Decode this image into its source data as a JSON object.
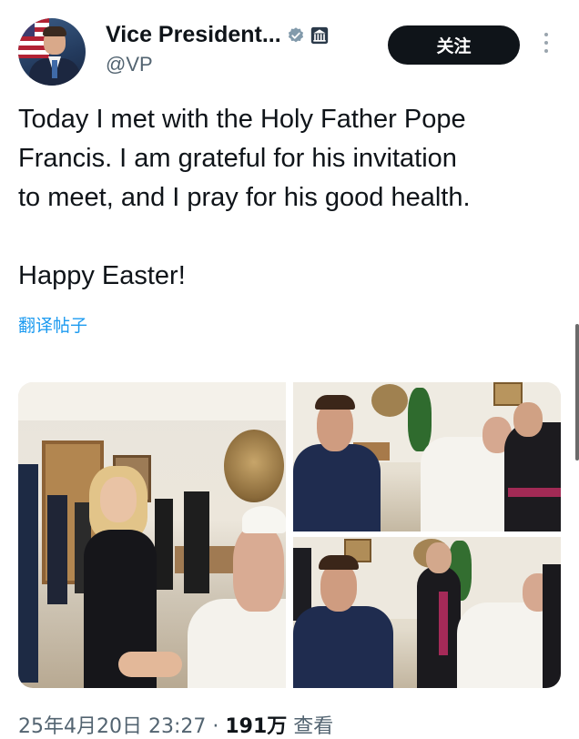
{
  "author": {
    "display_name": "Vice President...",
    "handle": "@VP"
  },
  "actions": {
    "follow_label": "关注"
  },
  "tweet": {
    "lines": [
      "Today I met with the Holy Father Pope",
      "Francis. I am grateful for his invitation",
      "to meet, and I pray for his good health."
    ],
    "closing": "Happy Easter!",
    "translate_label": "翻译帖子"
  },
  "meta": {
    "date_time": "25年4月20日 23:27 · ",
    "views_count": "191万",
    "views_label": " 查看"
  },
  "icons": {
    "verified": "verified-badge-icon",
    "government": "government-building-icon",
    "more": "more-options-icon"
  },
  "colors": {
    "follow_button": "#0f1419",
    "link": "#1d9bf0",
    "secondary_text": "#536471"
  }
}
